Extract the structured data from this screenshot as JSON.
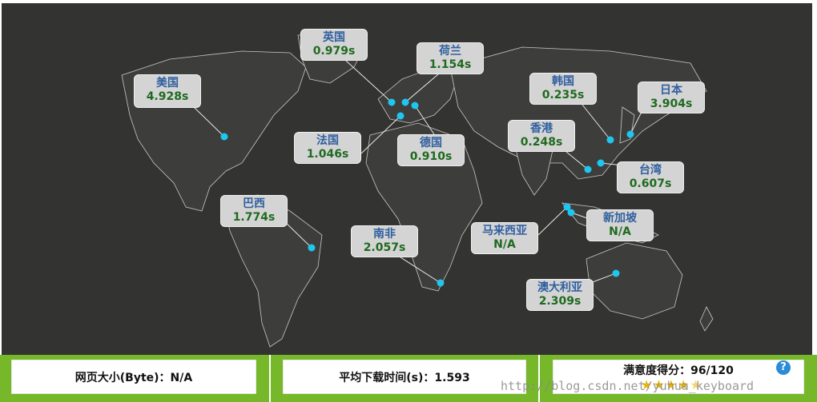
{
  "map": {
    "locations": [
      {
        "key": "us",
        "name": "美国",
        "time": "4.928s"
      },
      {
        "key": "uk",
        "name": "英国",
        "time": "0.979s"
      },
      {
        "key": "nl",
        "name": "荷兰",
        "time": "1.154s"
      },
      {
        "key": "kr",
        "name": "韩国",
        "time": "0.235s"
      },
      {
        "key": "jp",
        "name": "日本",
        "time": "3.904s"
      },
      {
        "key": "fr",
        "name": "法国",
        "time": "1.046s"
      },
      {
        "key": "de",
        "name": "德国",
        "time": "0.910s"
      },
      {
        "key": "hk",
        "name": "香港",
        "time": "0.248s"
      },
      {
        "key": "tw",
        "name": "台湾",
        "time": "0.607s"
      },
      {
        "key": "br",
        "name": "巴西",
        "time": "1.774s"
      },
      {
        "key": "za",
        "name": "南非",
        "time": "2.057s"
      },
      {
        "key": "my",
        "name": "马来西亚",
        "time": "N/A"
      },
      {
        "key": "sg",
        "name": "新加坡",
        "time": "N/A"
      },
      {
        "key": "au",
        "name": "澳大利亚",
        "time": "2.309s"
      }
    ]
  },
  "stats": {
    "page_size": "网页大小(Byte)：N/A",
    "avg_time": "平均下载时间(s)：1.593",
    "satisfaction": "满意度得分：96/120",
    "stars_rating_of_5": 4.5,
    "help_icon": "?"
  },
  "watermark": "http://blog.csdn.net/yuhua_keyboard",
  "colors": {
    "map_bg": "#333331",
    "dot": "#1ec6f0",
    "bar": "#76b82a",
    "name": "#2f5f9f",
    "time": "#1f6a1f"
  }
}
